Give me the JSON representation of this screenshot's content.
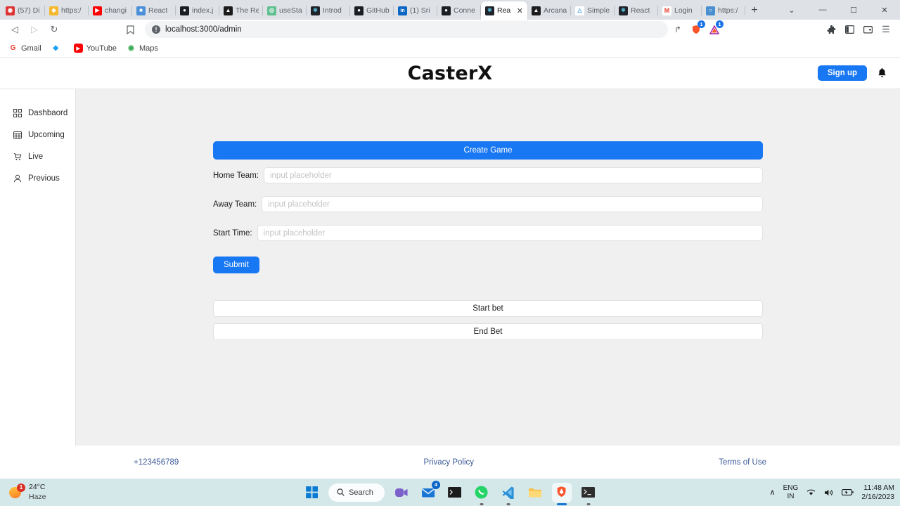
{
  "browser": {
    "tabs": [
      {
        "title": "(57) Di",
        "favicon_color": "#d33",
        "favicon_glyph": "◉",
        "active": false
      },
      {
        "title": "https:/",
        "favicon_color": "#f5b82e",
        "favicon_glyph": "◆",
        "active": false
      },
      {
        "title": "changi",
        "favicon_color": "#ff0000",
        "favicon_glyph": "▶",
        "active": false
      },
      {
        "title": "React ",
        "favicon_color": "#4a90d9",
        "favicon_glyph": "■",
        "active": false
      },
      {
        "title": "index.j",
        "favicon_color": "#1b1f23",
        "favicon_glyph": "●",
        "active": false
      },
      {
        "title": "The Re",
        "favicon_color": "#1c1c1c",
        "favicon_glyph": "▲",
        "active": false
      },
      {
        "title": "useSta",
        "favicon_color": "#5fbf8f",
        "favicon_glyph": "◎",
        "active": false
      },
      {
        "title": "Introd",
        "favicon_color": "#20232a",
        "favicon_glyph": "⚛",
        "active": false
      },
      {
        "title": "GitHub",
        "favicon_color": "#1b1f23",
        "favicon_glyph": "●",
        "active": false
      },
      {
        "title": "(1) Sri",
        "favicon_color": "#0a66c2",
        "favicon_glyph": "in",
        "active": false
      },
      {
        "title": "Conne",
        "favicon_color": "#1b1f23",
        "favicon_glyph": "●",
        "active": false
      },
      {
        "title": "Rea",
        "favicon_color": "#20232a",
        "favicon_glyph": "⚛",
        "active": true,
        "close": "✕"
      },
      {
        "title": "Arcana",
        "favicon_color": "#1c1c1c",
        "favicon_glyph": "▲",
        "active": false
      },
      {
        "title": "Simple",
        "favicon_color": "#ffffff",
        "favicon_glyph": "△",
        "active": false
      },
      {
        "title": "React ",
        "favicon_color": "#20232a",
        "favicon_glyph": "⚛",
        "active": false
      },
      {
        "title": "Login ",
        "favicon_color": "#ffffff",
        "favicon_glyph": "M",
        "active": false
      },
      {
        "title": "https:/",
        "favicon_color": "#4a8fd0",
        "favicon_glyph": "○",
        "active": false
      }
    ],
    "new_tab_label": "+",
    "window_controls": {
      "expand": "⌄",
      "minimize": "—",
      "maximize": "☐",
      "close": "✕"
    },
    "toolbar": {
      "back": "◁",
      "forward": "▷",
      "reload": "↻",
      "bookmark_star": "☐",
      "url": "localhost:3000/admin",
      "info_glyph": "!",
      "share": "↱",
      "brave_shield_badge": "1",
      "brave_rewards_badge": "1",
      "extensions": "🧩",
      "sidebar": "◧",
      "wallet": "▤",
      "menu": "☰"
    },
    "bookmarks": [
      {
        "label": "Gmail",
        "glyph": "G",
        "color": "#ea4335"
      },
      {
        "label": "",
        "glyph": "◆",
        "color": "#1da1f2"
      },
      {
        "label": "YouTube",
        "glyph": "▶",
        "color": "#ff0000"
      },
      {
        "label": "Maps",
        "glyph": "◉",
        "color": "#34a853"
      }
    ]
  },
  "app": {
    "title": "CasterX",
    "signup_label": "Sign up",
    "bell_icon": "🔔",
    "sidebar": {
      "items": [
        {
          "label": "Dashbaord",
          "icon": "grid-icon"
        },
        {
          "label": "Upcoming",
          "icon": "calendar-icon"
        },
        {
          "label": "Live",
          "icon": "cart-icon"
        },
        {
          "label": "Previous",
          "icon": "person-icon"
        }
      ]
    },
    "form": {
      "create_game_label": "Create Game",
      "fields": [
        {
          "label": "Home Team:",
          "value": "",
          "placeholder": "input placeholder"
        },
        {
          "label": "Away Team:",
          "value": "",
          "placeholder": "input placeholder"
        },
        {
          "label": "Start Time:",
          "value": "",
          "placeholder": "input placeholder"
        }
      ],
      "submit_label": "Submit",
      "start_bet_label": "Start bet",
      "end_bet_label": "End Bet"
    },
    "footer": {
      "phone": "+123456789",
      "privacy": "Privacy Policy",
      "terms": "Terms of Use"
    },
    "colors": {
      "primary": "#1877f2",
      "content_bg": "#f0f0f0",
      "link": "#3b5998"
    }
  },
  "taskbar": {
    "weather": {
      "temp": "24°C",
      "condition": "Haze",
      "badge": "1"
    },
    "search_label": "Search",
    "start_icon": "windows-icon",
    "apps": [
      {
        "name": "teams",
        "glyph": "▣",
        "color": "#6264a7",
        "badge": "",
        "running": false
      },
      {
        "name": "mail",
        "glyph": "✉",
        "color": "#0a64c8",
        "badge": "4",
        "running": false
      },
      {
        "name": "terminal",
        "glyph": "■",
        "color": "#1a1a1a",
        "badge": "",
        "running": false
      },
      {
        "name": "whatsapp",
        "glyph": "✆",
        "color": "#25d366",
        "badge": "",
        "running": true
      },
      {
        "name": "vscode",
        "glyph": "⬡",
        "color": "#007acc",
        "badge": "",
        "running": true
      },
      {
        "name": "file-explorer",
        "glyph": "▬",
        "color": "#ffc83d",
        "badge": "",
        "running": false
      },
      {
        "name": "brave",
        "glyph": "▲",
        "color": "#fb542b",
        "badge": "",
        "running": true
      },
      {
        "name": "powershell",
        "glyph": "■",
        "color": "#2d2d2d",
        "badge": "",
        "running": true
      }
    ],
    "tray": {
      "chevron": "∧",
      "lang_line1": "ENG",
      "lang_line2": "IN",
      "wifi": "📶",
      "volume": "🔊",
      "battery": "🔋",
      "time": "11:48 AM",
      "date": "2/16/2023"
    }
  }
}
